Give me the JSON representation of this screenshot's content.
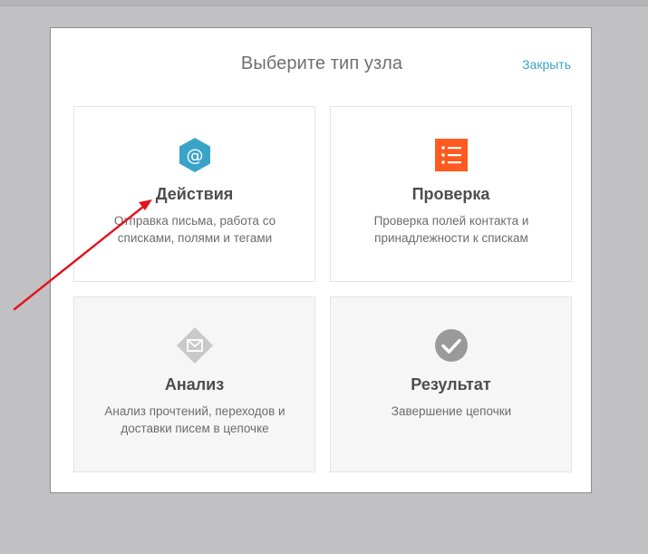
{
  "modal": {
    "title": "Выберите тип узла",
    "close_label": "Закрыть"
  },
  "cards": [
    {
      "title": "Действия",
      "description": "Отправка письма, работа со списками, полями и тегами",
      "icon": "at-sign-hexagon-icon",
      "icon_color": "#3aa4c8"
    },
    {
      "title": "Проверка",
      "description": "Проверка полей контакта и принадлежности к спискам",
      "icon": "checklist-icon",
      "icon_color": "#ff5a1f"
    },
    {
      "title": "Анализ",
      "description": "Анализ прочтений, переходов и доставки писем в цепочке",
      "icon": "envelope-diamond-icon",
      "icon_color": "#c9c9c9"
    },
    {
      "title": "Результат",
      "description": "Завершение цепочки",
      "icon": "checkmark-circle-icon",
      "icon_color": "#9a9a9a"
    }
  ],
  "colors": {
    "backdrop": "#c1c1c4",
    "accent_link": "#3aa4c8",
    "annotation_arrow": "#e0141e"
  }
}
